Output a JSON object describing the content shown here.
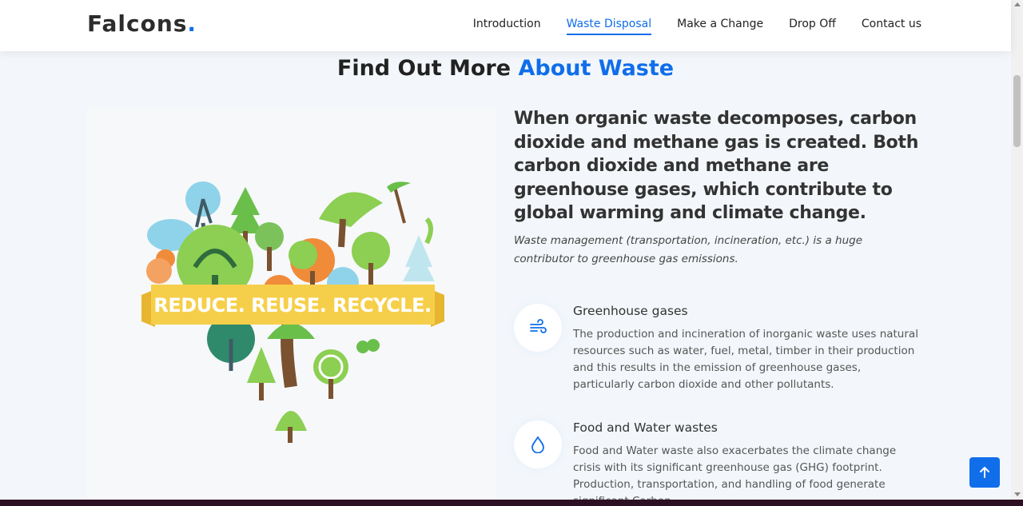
{
  "brand": {
    "name": "Falcons",
    "dot": "."
  },
  "nav": {
    "items": [
      {
        "label": "Introduction",
        "active": false
      },
      {
        "label": "Waste Disposal",
        "active": true
      },
      {
        "label": "Make a Change",
        "active": false
      },
      {
        "label": "Drop Off",
        "active": false
      },
      {
        "label": "Contact us",
        "active": false
      }
    ]
  },
  "section": {
    "title_prefix": "Find Out More",
    "title_accent": "About Waste"
  },
  "image": {
    "banner_text": "REDUCE. REUSE. RECYCLE."
  },
  "content": {
    "lead": "When organic waste decomposes, carbon dioxide and methane gas is created. Both carbon dioxide and methane are greenhouse gases, which contribute to global warming and climate change.",
    "lead_sub": "Waste management (transportation, incineration, etc.) is a huge contributor to greenhouse gas emissions.",
    "features": [
      {
        "icon": "wind-icon",
        "title": "Greenhouse gases",
        "text": "The production and incineration of inorganic waste uses natural resources such as water, fuel, metal, timber in their production and this results in the emission of greenhouse gases, particularly carbon dioxide and other pollutants."
      },
      {
        "icon": "droplet-icon",
        "title": "Food and Water wastes",
        "text": "Food and Water waste also exacerbates the climate change crisis with its significant greenhouse gas (GHG) footprint. Production, transportation, and handling of food generate significant Carbon"
      }
    ]
  },
  "colors": {
    "accent": "#106eea",
    "banner": "#f6cf4a"
  }
}
